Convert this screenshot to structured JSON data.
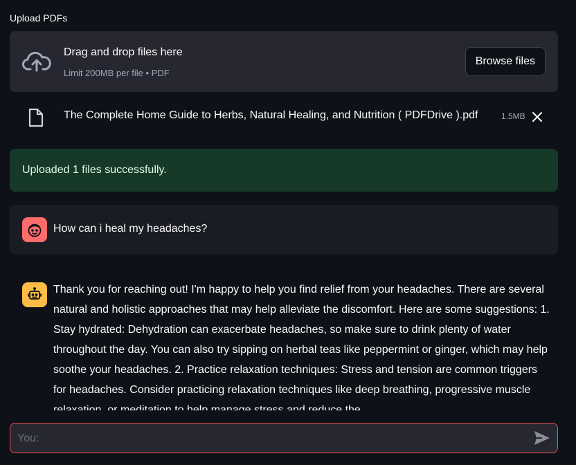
{
  "uploader": {
    "label": "Upload PDFs",
    "drop_title": "Drag and drop files here",
    "drop_subtitle": "Limit 200MB per file • PDF",
    "browse_label": "Browse files",
    "cloud_icon": "cloud-upload-icon"
  },
  "file": {
    "name": "The Complete Home Guide to Herbs, Natural Healing, and Nutrition ( PDFDrive ).pdf",
    "size": "1.5MB",
    "icon": "file-icon"
  },
  "status": {
    "message": "Uploaded 1 files successfully.",
    "color": "#173928"
  },
  "chat": {
    "messages": [
      {
        "role": "user",
        "avatar_icon": "user-face-icon",
        "avatar_color": "#ff6c6c",
        "text": "How can i heal my headaches?"
      },
      {
        "role": "assistant",
        "avatar_icon": "robot-icon",
        "avatar_color": "#ffbd45",
        "text": "Thank you for reaching out! I'm happy to help you find relief from your headaches. There are several natural and holistic approaches that may help alleviate the discomfort. Here are some suggestions: 1. Stay hydrated: Dehydration can exacerbate headaches, so make sure to drink plenty of water throughout the day. You can also try sipping on herbal teas like peppermint or ginger, which may help soothe your headaches. 2. Practice relaxation techniques: Stress and tension are common triggers for headaches. Consider practicing relaxation techniques like deep breathing, progressive muscle relaxation, or meditation to help manage stress and reduce the"
      }
    ],
    "input_placeholder": "You:",
    "input_value": "",
    "send_icon": "send-icon",
    "accent_color": "#ff4b4b"
  }
}
